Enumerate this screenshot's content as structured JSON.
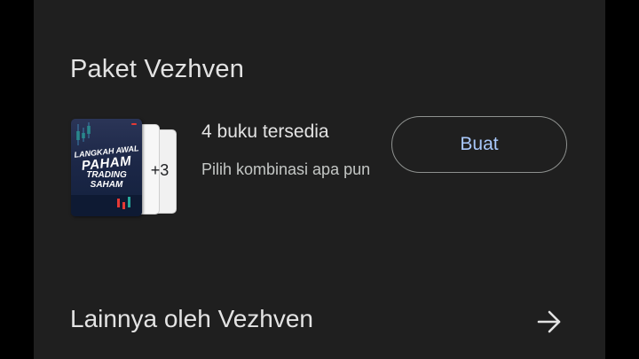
{
  "section": {
    "title": "Paket Vezhven"
  },
  "bundle": {
    "extra_count": "+3",
    "cover": {
      "badge": "",
      "line1": "LANGKAH AWAL",
      "line2": "PAHAM",
      "line3": "TRADING",
      "line4": "SAHAM"
    },
    "title": "4 buku tersedia",
    "subtitle": "Pilih kombinasi apa pun",
    "button_label": "Buat"
  },
  "more": {
    "label": "Lainnya oleh Vezhven",
    "icon": "arrow-right-icon"
  },
  "colors": {
    "background": "#1f1f1f",
    "text": "#e3e3e3",
    "accent": "#a8c7fa"
  }
}
